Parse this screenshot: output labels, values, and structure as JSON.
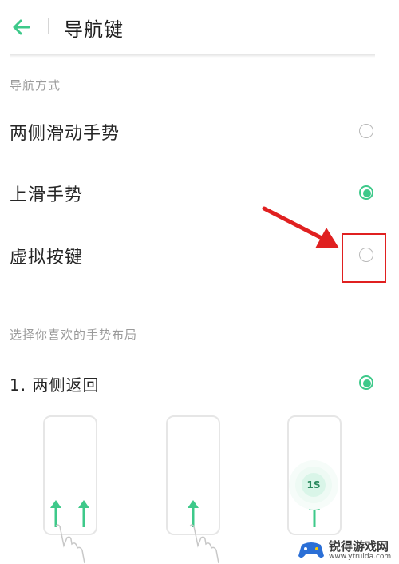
{
  "header": {
    "title": "导航键"
  },
  "nav_section": {
    "label": "导航方式",
    "options": [
      {
        "label": "两侧滑动手势",
        "selected": false
      },
      {
        "label": "上滑手势",
        "selected": true
      },
      {
        "label": "虚拟按键",
        "selected": false
      }
    ]
  },
  "layout_section": {
    "label": "选择你喜欢的手势布局",
    "options": [
      {
        "label": "1. 两侧返回",
        "selected": true
      }
    ]
  },
  "illustration": {
    "timer_label": "1S"
  },
  "watermark": {
    "name": "锐得游戏网",
    "url": "www.ytruida.com"
  },
  "colors": {
    "accent": "#3ec98a",
    "highlight": "#e02020"
  }
}
